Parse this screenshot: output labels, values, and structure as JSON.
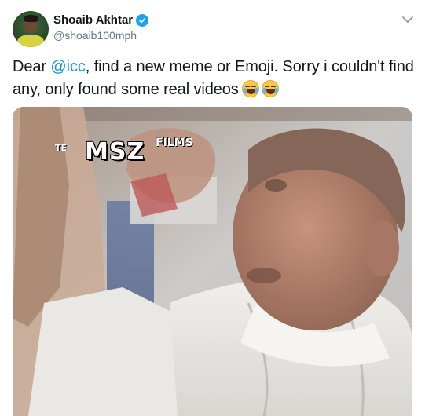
{
  "tweet": {
    "author_name": "Shoaib Akhtar",
    "author_handle": "@shoaib100mph",
    "verified": true,
    "text_prefix": "Dear ",
    "mention": "@icc",
    "text_suffix": ", find a new meme or Emoji. Sorry i couldn't find any, only found some real videos",
    "emojis": [
      "face-with-tears-of-joy",
      "face-with-tears-of-joy"
    ]
  },
  "media": {
    "type": "video-frame",
    "watermark_brand": "MSZ",
    "watermark_films": "FILMS",
    "watermark_prefix": "TE"
  },
  "colors": {
    "link": "#1b95e0",
    "verified": "#1da1f2",
    "handle": "#657786",
    "text": "#14171a"
  },
  "icons": {
    "verified": "verified-badge-icon",
    "menu": "chevron-down-icon",
    "emoji": "face-with-tears-of-joy-icon"
  }
}
